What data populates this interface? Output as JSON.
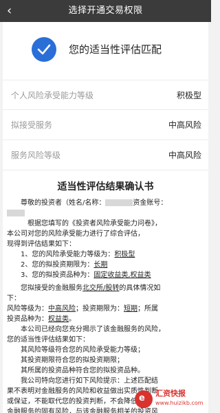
{
  "header": {
    "title": "选择开通交易权限",
    "back_icon": "‹"
  },
  "result": {
    "text": "您的适当性评估匹配"
  },
  "rows": [
    {
      "label": "个人风险承受能力等级",
      "value": "积极型"
    },
    {
      "label": "拟接受服务",
      "value": "中高风险"
    },
    {
      "label": "服务风险等级",
      "value": "中高风险"
    }
  ],
  "confirm": {
    "title": "适当性评估结果确认书",
    "greeting_a": "尊敬的投资者（姓名/名称：",
    "greeting_b": "资金账号：",
    "p1a": "根据您填写的《投资者风险承受能力问卷》，",
    "p1b": "本公司对您的风险承受能力进行了综合评估，",
    "p1c": "现得到评估结果如下：",
    "item1_label": "1、您的风险承受能力等级为：",
    "item1_value": "积极型",
    "item2_label": "2、您的拟投资期限为：",
    "item2_value": "长期",
    "item3_label": "3、您的拟投资品种为：",
    "item3_value": "固定收益类,权益类",
    "p2a": "您拟接受的金融服务",
    "p2b": "北交所/股转",
    "p2c": "的具体情况如",
    "p3a": "下：",
    "p4a": "风险等级为：",
    "p4b": "中高风险",
    "p4c": "；投资期限为：",
    "p4d": "短期",
    "p4e": "；所属",
    "p5a": "投资品种为：",
    "p5b": "权益类",
    "p5c": "。",
    "p6": "本公司已经向您充分揭示了该金融服务的风险，",
    "p7": "您的适当性评估结果如下：",
    "p8": "其风险等级符合您的风险承受能力等级；",
    "p9": "其投资期限符合您的拟投资期限；",
    "p10": "其所属的投资品种符合您的拟投资品种。",
    "p11": "我公司特向您进行如下风险提示：上述匹配结",
    "p12": "果不表明对金融服务的风险和收益做出实质性判断",
    "p13": "或保证，不能取代您的投资判断，不会降低",
    "p14": "金融服务的固有风险，与该金融服务相关的投资风"
  },
  "watermark": {
    "brand": "汇资快报",
    "url": "www.huizikb.com",
    "logo_letter": "e"
  }
}
